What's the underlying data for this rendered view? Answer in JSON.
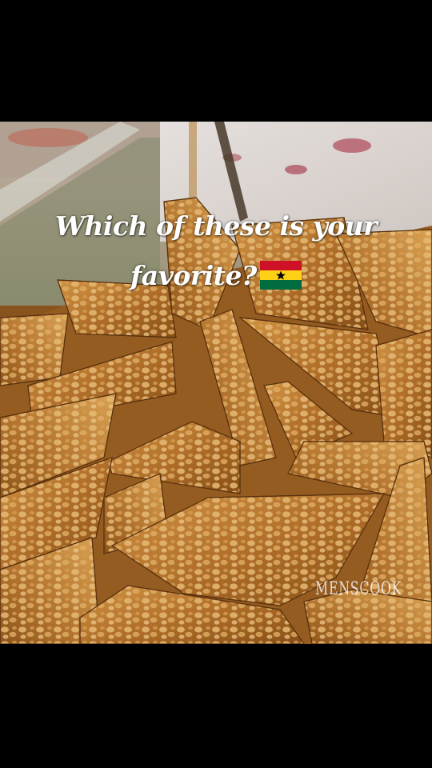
{
  "post": {
    "caption_line1": "Which of these is your",
    "caption_line2": "favorite?",
    "caption_emoji": "ghana-flag",
    "watermark": "MENSCOOK",
    "image_subject": "peanut brittle pieces (nkate cake)"
  },
  "colors": {
    "background": "#000000",
    "brittle_base": "#b06a22",
    "brittle_highlight": "#e0a04c",
    "flag_red": "#ce1126",
    "flag_gold": "#fcd116",
    "flag_green": "#006b3f",
    "flag_star": "#000000"
  }
}
